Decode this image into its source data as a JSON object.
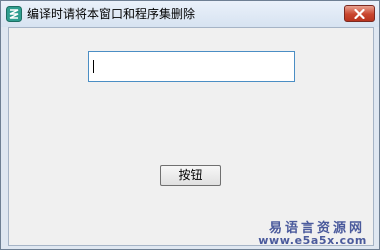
{
  "window": {
    "title": "编译时请将本窗口和程序集删除"
  },
  "titlebar": {
    "app_icon": "app-icon",
    "close_icon": "close-icon"
  },
  "form": {
    "text_input_value": "",
    "button_label": "按钮"
  },
  "watermark": {
    "site_name": "易语言资源网",
    "url": "www.e5a5x.com"
  },
  "colors": {
    "close_button": "#c9462f",
    "input_border": "#4b8ec4",
    "watermark": "#4a5a9c"
  }
}
